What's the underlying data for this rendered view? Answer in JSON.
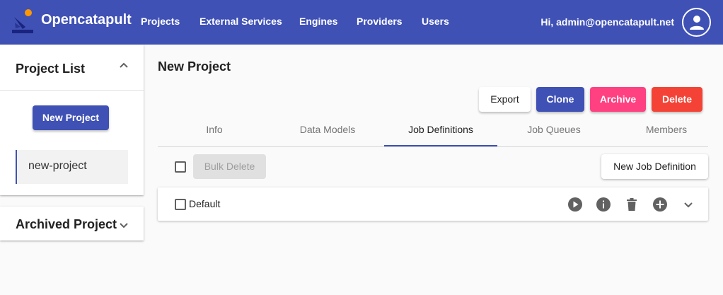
{
  "header": {
    "brand": "Opencatapult",
    "nav": [
      "Projects",
      "External Services",
      "Engines",
      "Providers",
      "Users"
    ],
    "greeting": "Hi, admin@opencatapult.net",
    "account_icon": "account-circle-icon"
  },
  "sidebar": {
    "project_list_title": "Project List",
    "new_project_label": "New Project",
    "projects": [
      "new-project"
    ],
    "archived_title": "Archived Project"
  },
  "main": {
    "title": "New Project",
    "actions": {
      "export": "Export",
      "clone": "Clone",
      "archive": "Archive",
      "delete": "Delete"
    },
    "tabs": [
      "Info",
      "Data Models",
      "Job Definitions",
      "Job Queues",
      "Members"
    ],
    "active_tab": "Job Definitions",
    "bulk_delete_label": "Bulk Delete",
    "new_job_definition_label": "New Job Definition",
    "job_definitions": [
      {
        "name": "Default"
      }
    ],
    "row_icons": [
      "play-icon",
      "info-icon",
      "trash-icon",
      "add-circle-icon",
      "expand-icon"
    ]
  },
  "colors": {
    "primary": "#3f51b5",
    "accent": "#ff4081",
    "warn": "#f44336",
    "logo_dot": "#ff9800"
  }
}
